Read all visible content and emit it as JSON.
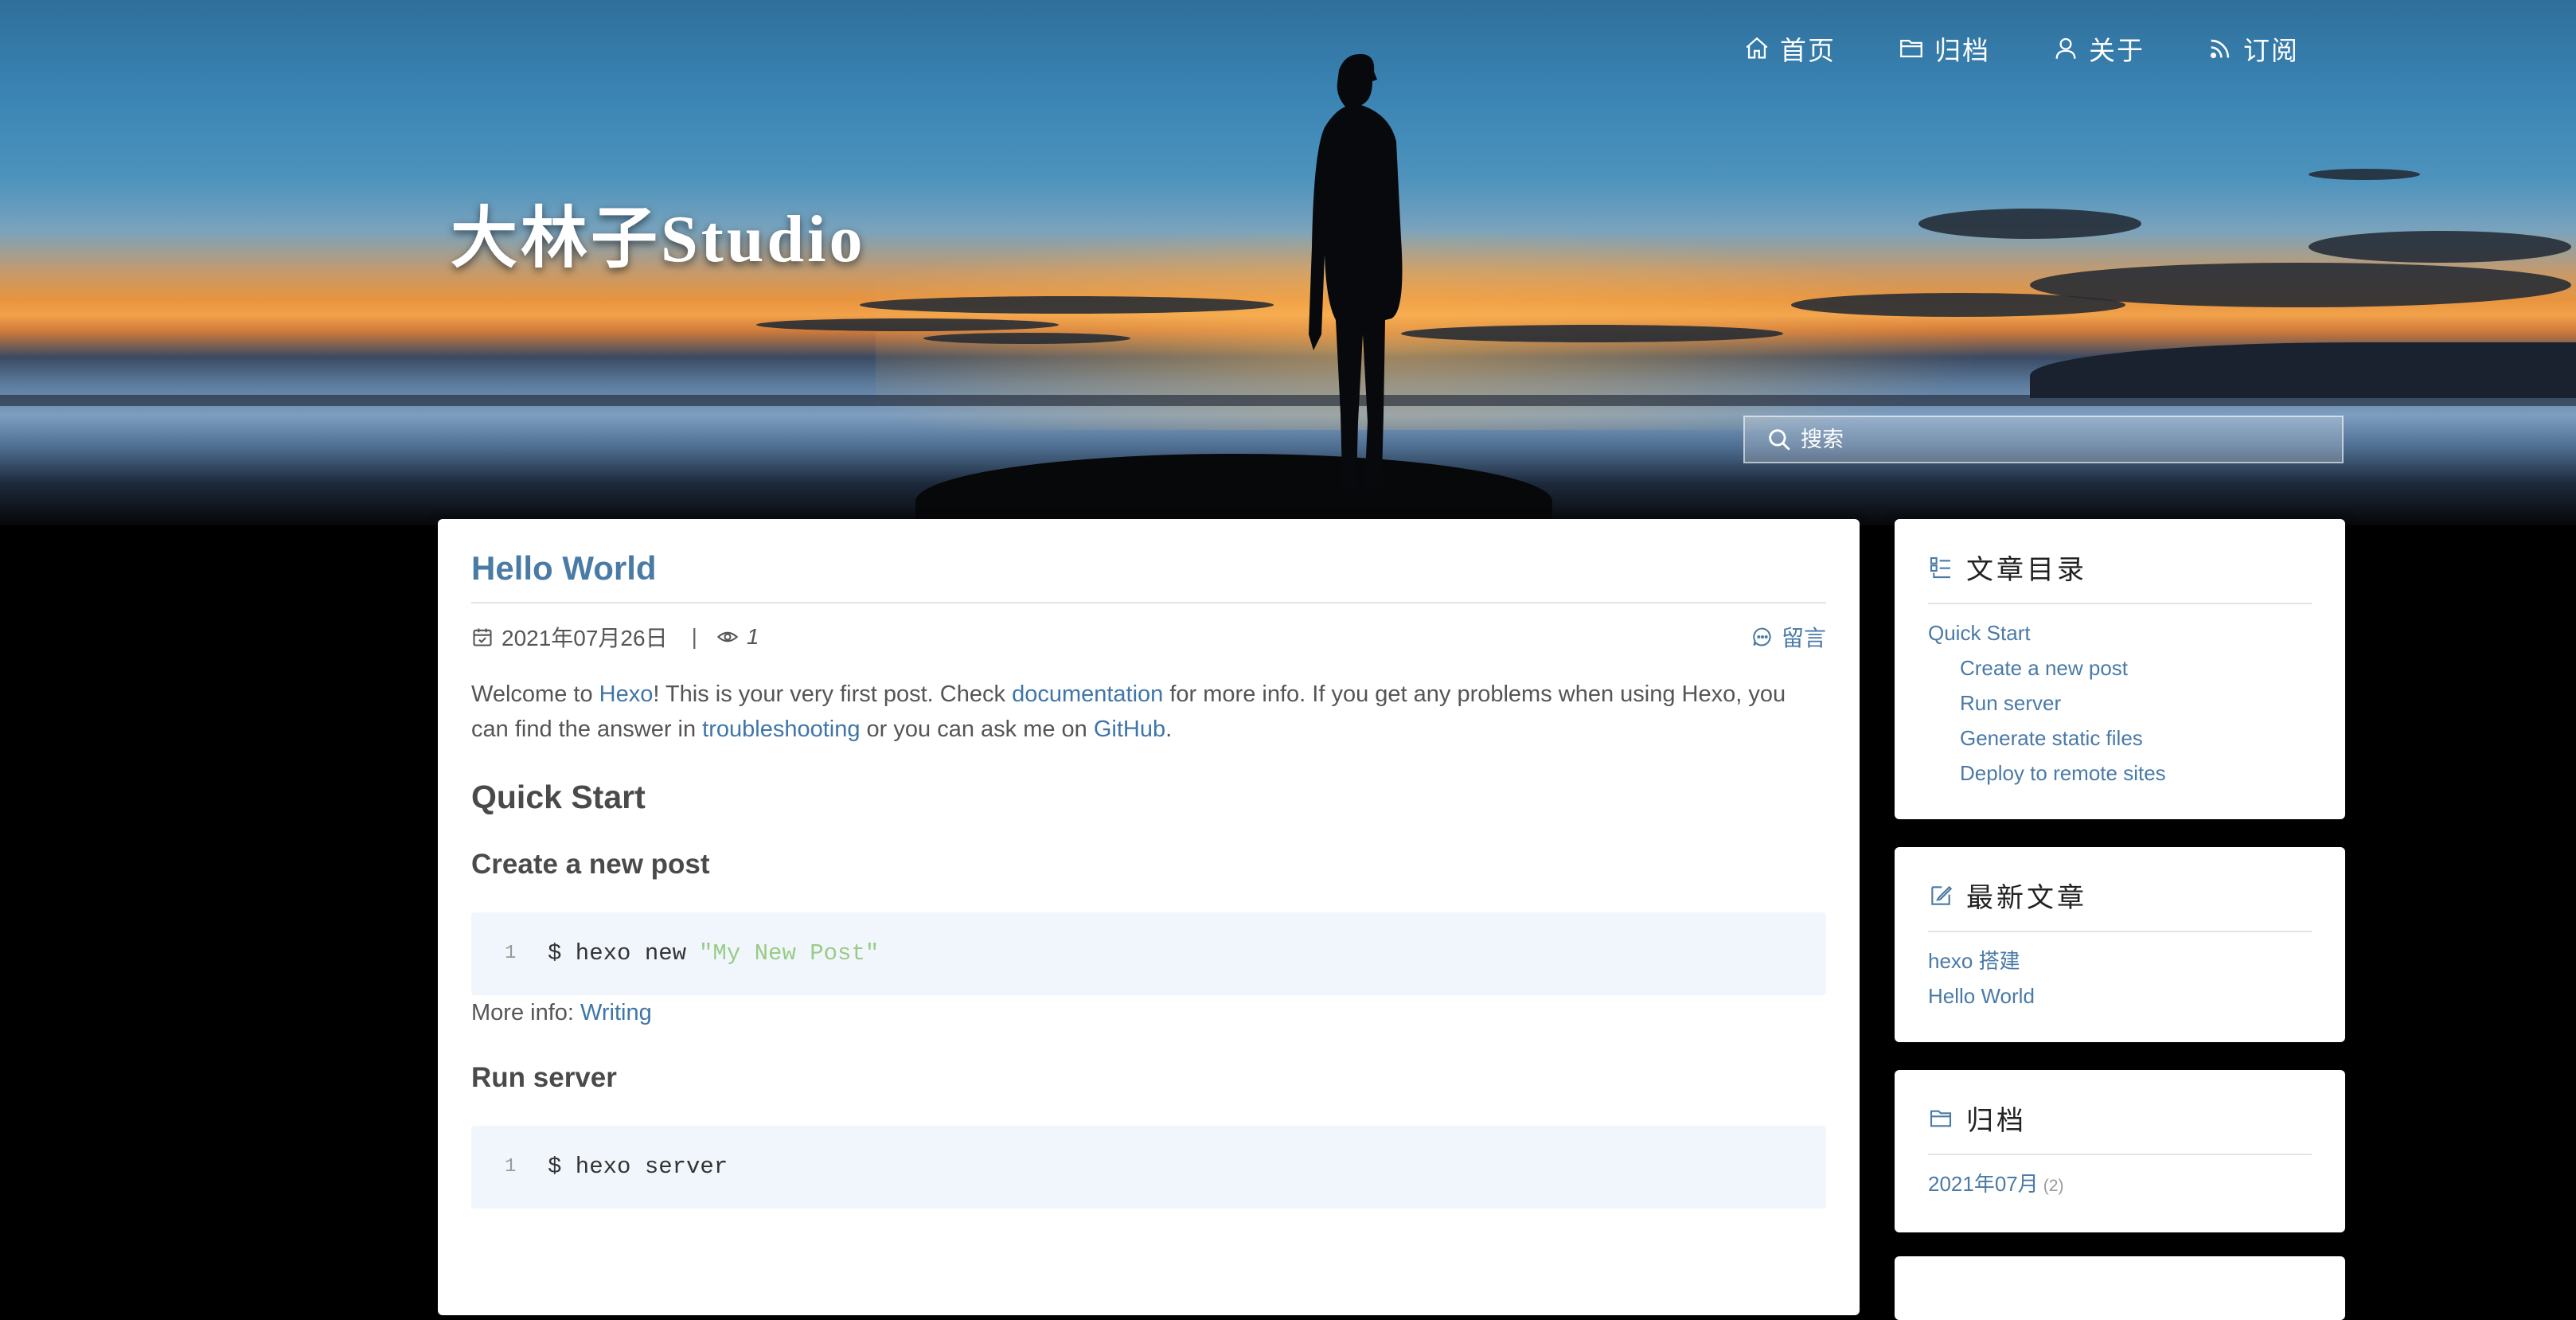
{
  "nav": [
    {
      "label": "首页",
      "icon": "home-icon"
    },
    {
      "label": "归档",
      "icon": "folder-icon"
    },
    {
      "label": "关于",
      "icon": "user-icon"
    },
    {
      "label": "订阅",
      "icon": "rss-icon"
    }
  ],
  "site_title": "大林子Studio",
  "search": {
    "placeholder": "搜索"
  },
  "post": {
    "title": "Hello World",
    "date": "2021年07月26日",
    "separator": "|",
    "views": "1",
    "comment_label": "留言",
    "intro": {
      "t1": "Welcome to ",
      "link1": "Hexo",
      "t2": "! This is your very first post. Check ",
      "link2": "documentation",
      "t3": " for more info. If you get any problems when using Hexo, you can find the answer in ",
      "link3": "troubleshooting",
      "t4": " or you can ask me on ",
      "link4": "GitHub",
      "t5": "."
    },
    "h_quick_start": "Quick Start",
    "h_create_post": "Create a new post",
    "code1": {
      "line": "1",
      "cmd": "$ hexo new",
      "arg": "\"My New Post\""
    },
    "more_info_label": "More info: ",
    "more_info_link": "Writing",
    "h_run_server": "Run server",
    "code2": {
      "line": "1",
      "cmd": "$ hexo server"
    }
  },
  "sidebar": {
    "toc": {
      "title": "文章目录",
      "items": [
        {
          "label": "Quick Start"
        },
        {
          "label": "Create a new post"
        },
        {
          "label": "Run server"
        },
        {
          "label": "Generate static files"
        },
        {
          "label": "Deploy to remote sites"
        }
      ]
    },
    "recent": {
      "title": "最新文章",
      "items": [
        {
          "label": "hexo 搭建"
        },
        {
          "label": "Hello World"
        }
      ]
    },
    "archive": {
      "title": "归档",
      "items": [
        {
          "label": "2021年07月",
          "count": "(2)"
        }
      ]
    }
  }
}
